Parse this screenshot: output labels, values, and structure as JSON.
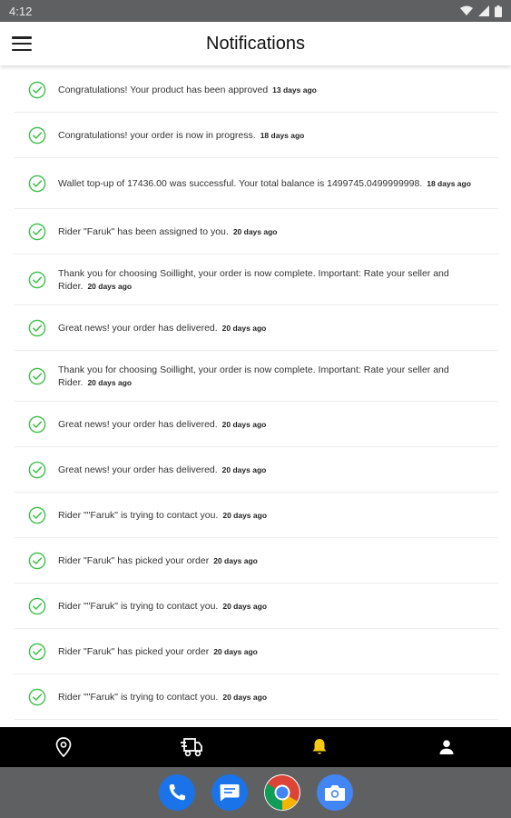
{
  "status_bar": {
    "time": "4:12"
  },
  "header": {
    "title": "Notifications"
  },
  "colors": {
    "check": "#3dbf4a",
    "active_nav": "#f6c915",
    "nav_bg": "#000000",
    "system_bg": "#5f6062"
  },
  "notifications": [
    {
      "message": "Congratulations! Your product has been approved",
      "time": "13 days ago"
    },
    {
      "message": "Congratulations! your order is now in progress.",
      "time": "18 days ago"
    },
    {
      "message": "Wallet top-up of 17436.00 was successful. Your total balance is 1499745.0499999998.",
      "time": "18 days ago"
    },
    {
      "message": "Rider \"Faruk\" has been assigned to you.",
      "time": "20 days ago"
    },
    {
      "message": "Thank you for choosing Soillight, your order is now complete. Important: Rate your seller and Rider.",
      "time": "20 days ago"
    },
    {
      "message": "Great news! your order has delivered.",
      "time": "20 days ago"
    },
    {
      "message": "Thank you for choosing Soillight, your order is now complete. Important: Rate your seller and Rider.",
      "time": "20 days ago"
    },
    {
      "message": "Great news! your order has delivered.",
      "time": "20 days ago"
    },
    {
      "message": "Great news! your order has delivered.",
      "time": "20 days ago"
    },
    {
      "message": "Rider \"\"Faruk\" is trying to contact you.",
      "time": "20 days ago"
    },
    {
      "message": "Rider \"Faruk\" has picked your order",
      "time": "20 days ago"
    },
    {
      "message": "Rider \"\"Faruk\" is trying to contact you.",
      "time": "20 days ago"
    },
    {
      "message": "Rider \"Faruk\" has picked your order",
      "time": "20 days ago"
    },
    {
      "message": "Rider \"\"Faruk\" is trying to contact you.",
      "time": "20 days ago"
    }
  ],
  "bottom_nav": [
    {
      "icon": "location-pin-icon",
      "active": false
    },
    {
      "icon": "delivery-truck-icon",
      "active": false
    },
    {
      "icon": "bell-icon",
      "active": true
    },
    {
      "icon": "person-icon",
      "active": false
    }
  ],
  "dock": [
    {
      "icon": "phone-icon"
    },
    {
      "icon": "messages-icon"
    },
    {
      "icon": "chrome-icon"
    },
    {
      "icon": "camera-icon"
    }
  ]
}
